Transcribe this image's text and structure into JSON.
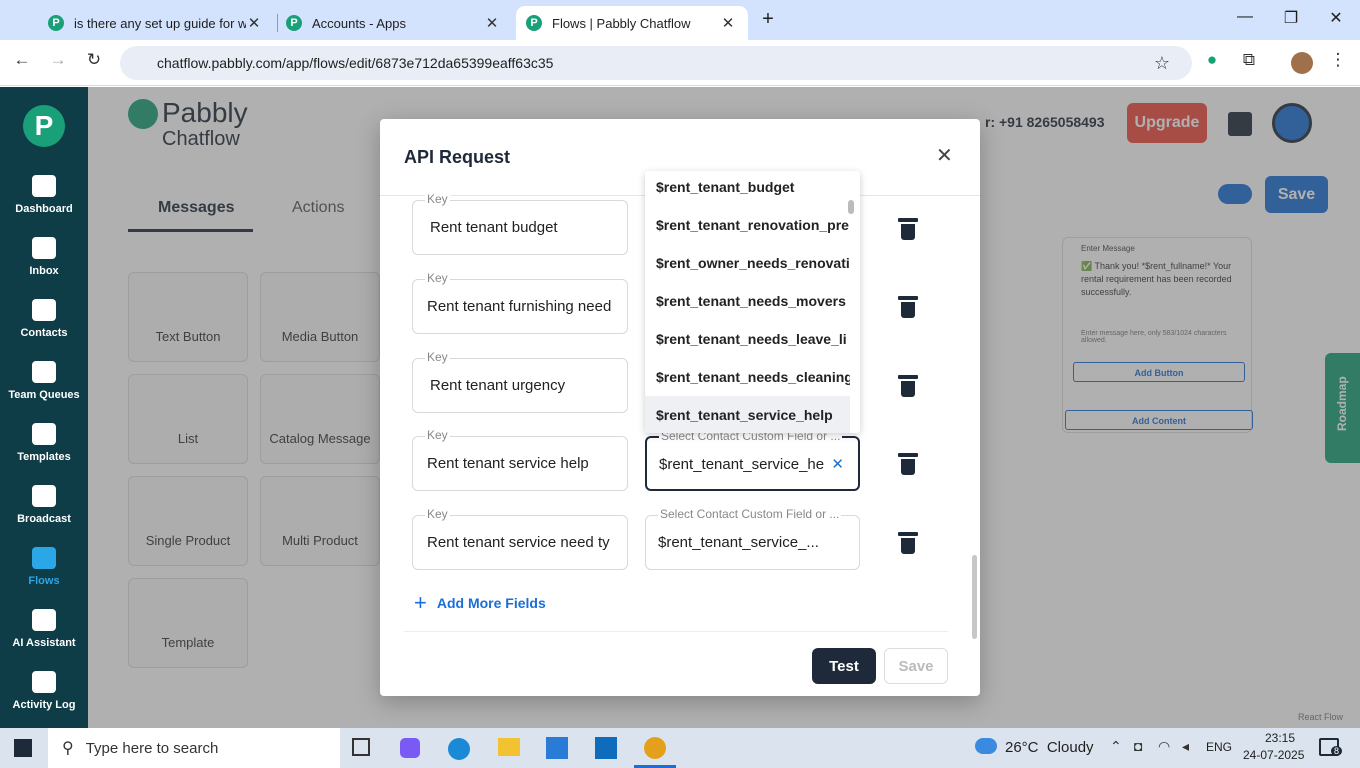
{
  "browser": {
    "tabs": [
      {
        "title": "is there any set up guide for we"
      },
      {
        "title": "Accounts - Apps"
      },
      {
        "title": "Flows | Pabbly Chatflow"
      }
    ],
    "url": "chatflow.pabbly.com/app/flows/edit/6873e712da65399eaff63c35"
  },
  "header": {
    "logo_line1": "Pabbly",
    "logo_line2": "Chatflow",
    "phone": "+91 8265058493",
    "upgrade": "Upgrade",
    "save": "Save"
  },
  "sidebar": {
    "items": [
      {
        "label": "Dashboard"
      },
      {
        "label": "Inbox"
      },
      {
        "label": "Contacts"
      },
      {
        "label": "Team Queues"
      },
      {
        "label": "Templates"
      },
      {
        "label": "Broadcast"
      },
      {
        "label": "Flows"
      },
      {
        "label": "AI Assistant"
      },
      {
        "label": "Activity Log"
      }
    ]
  },
  "panel": {
    "tabs": [
      "Messages",
      "Actions"
    ],
    "cards": [
      "Text Button",
      "Media Button",
      "List",
      "Catalog Message",
      "Single Product",
      "Multi Product",
      "Template"
    ]
  },
  "canvas": {
    "enter_message": "Enter Message",
    "message": "✅ Thank you! *$rent_fullname!* Your rental requirement has been recorded successfully.",
    "hint": "Enter message here, only 583/1024 characters allowed.",
    "add_button": "Add Button",
    "add_content": "Add Content",
    "roadmap": "Roadmap",
    "react_flow": "React Flow"
  },
  "modal": {
    "title": "API Request",
    "rows": [
      {
        "key_label": "Key",
        "key": "Rent tenant budget",
        "val_label": "",
        "val": ""
      },
      {
        "key_label": "Key",
        "key": "Rent tenant furnishing need",
        "val_label": "",
        "val": ""
      },
      {
        "key_label": "Key",
        "key": "Rent tenant urgency",
        "val_label": "",
        "val": ""
      },
      {
        "key_label": "Key",
        "key": "Rent tenant service help",
        "val_label": "Select Contact Custom Field or ...",
        "val": "$rent_tenant_service_he"
      },
      {
        "key_label": "Key",
        "key": "Rent tenant service need ty",
        "val_label": "Select Contact Custom Field or ...",
        "val": "$rent_tenant_service_..."
      }
    ],
    "dropdown": [
      "$rent_tenant_budget",
      "$rent_tenant_renovation_pre",
      "$rent_owner_needs_renovati",
      "$rent_tenant_needs_movers",
      "$rent_tenant_needs_leave_li",
      "$rent_tenant_needs_cleaning",
      "$rent_tenant_service_help"
    ],
    "add_more": "Add More Fields",
    "test": "Test",
    "save": "Save"
  },
  "taskbar": {
    "search": "Type here to search",
    "weather": "26°C  Cloudy",
    "lang": "ENG",
    "time": "23:15",
    "date": "24-07-2025",
    "notif": "8"
  }
}
